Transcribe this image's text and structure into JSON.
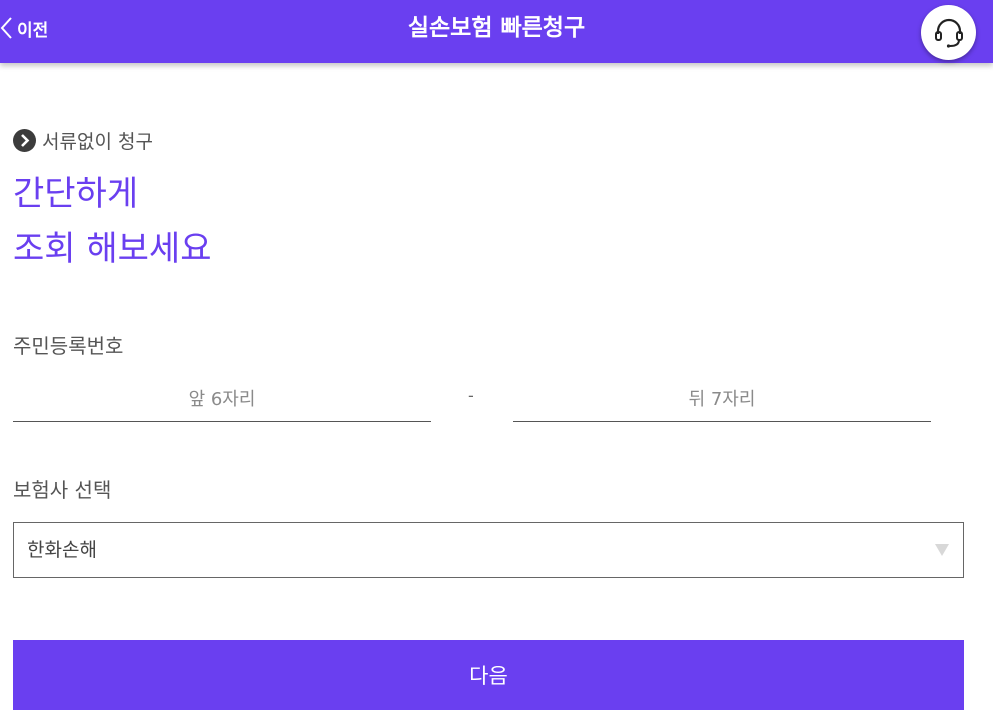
{
  "header": {
    "back_label": "이전",
    "title": "실손보험 빠른청구"
  },
  "intro": {
    "subtitle": "서류없이 청구",
    "headline_line1": "간단하게",
    "headline_line2": "조회 해보세요"
  },
  "rrn": {
    "label": "주민등록번호",
    "front_placeholder": "앞 6자리",
    "separator": "-",
    "back_placeholder": "뒤 7자리"
  },
  "insurer": {
    "label": "보험사 선택",
    "selected": "한화손해"
  },
  "next_button_label": "다음",
  "colors": {
    "accent": "#6a3ff0",
    "header_text": "#ffffff"
  },
  "icons": {
    "back": "chevron-left-icon",
    "support": "headset-icon",
    "subtitle_bullet": "chevron-circle-right-icon",
    "select_arrow": "triangle-down-icon"
  }
}
